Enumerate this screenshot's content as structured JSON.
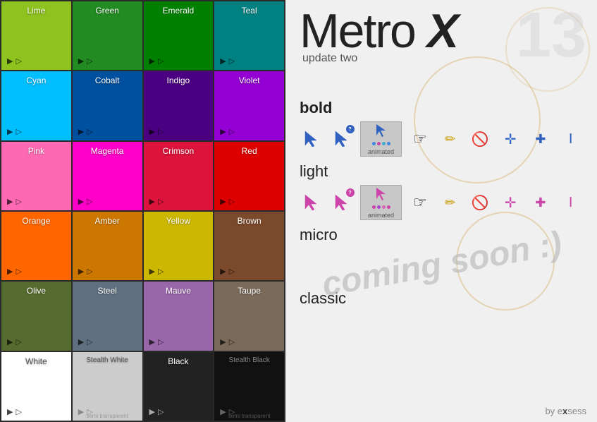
{
  "app": {
    "title_metro": "Metro ",
    "title_x": "X",
    "version_badge": "13",
    "subtitle": "update two",
    "footer": "by exsess"
  },
  "left_panel": {
    "tiles": [
      {
        "id": "lime",
        "label": "Lime",
        "class": "tile-lime"
      },
      {
        "id": "green",
        "label": "Green",
        "class": "tile-green"
      },
      {
        "id": "emerald",
        "label": "Emerald",
        "class": "tile-emerald"
      },
      {
        "id": "teal",
        "label": "Teal",
        "class": "tile-teal"
      },
      {
        "id": "cyan",
        "label": "Cyan",
        "class": "tile-cyan"
      },
      {
        "id": "cobalt",
        "label": "Cobalt",
        "class": "tile-cobalt"
      },
      {
        "id": "indigo",
        "label": "Indigo",
        "class": "tile-indigo"
      },
      {
        "id": "violet",
        "label": "Violet",
        "class": "tile-violet"
      },
      {
        "id": "pink",
        "label": "Pink",
        "class": "tile-pink"
      },
      {
        "id": "magenta",
        "label": "Magenta",
        "class": "tile-magenta"
      },
      {
        "id": "crimson",
        "label": "Crimson",
        "class": "tile-crimson"
      },
      {
        "id": "red",
        "label": "Red",
        "class": "tile-red"
      },
      {
        "id": "orange",
        "label": "Orange",
        "class": "tile-orange"
      },
      {
        "id": "amber",
        "label": "Amber",
        "class": "tile-amber"
      },
      {
        "id": "yellow",
        "label": "Yellow",
        "class": "tile-yellow"
      },
      {
        "id": "brown",
        "label": "Brown",
        "class": "tile-brown"
      },
      {
        "id": "olive",
        "label": "Olive",
        "class": "tile-olive"
      },
      {
        "id": "steel",
        "label": "Steel",
        "class": "tile-steel"
      },
      {
        "id": "mauve",
        "label": "Mauve",
        "class": "tile-mauve"
      },
      {
        "id": "taupe",
        "label": "Taupe",
        "class": "tile-taupe"
      },
      {
        "id": "white",
        "label": "White",
        "class": "tile-white"
      },
      {
        "id": "stealth-white",
        "label": "Stealth White",
        "class": "tile-stealth-white"
      },
      {
        "id": "black",
        "label": "Black",
        "class": "tile-black"
      },
      {
        "id": "stealth-black",
        "label": "Stealth Black",
        "class": "tile-stealth-black"
      }
    ]
  },
  "sections": {
    "bold": {
      "label": "bold"
    },
    "light": {
      "label": "light"
    },
    "micro": {
      "label": "micro",
      "coming_soon": "coming soon :)"
    },
    "classic": {
      "label": "classic"
    }
  },
  "cursor_rows": {
    "bold_animated_label": "animated",
    "light_animated_label": "animated"
  }
}
